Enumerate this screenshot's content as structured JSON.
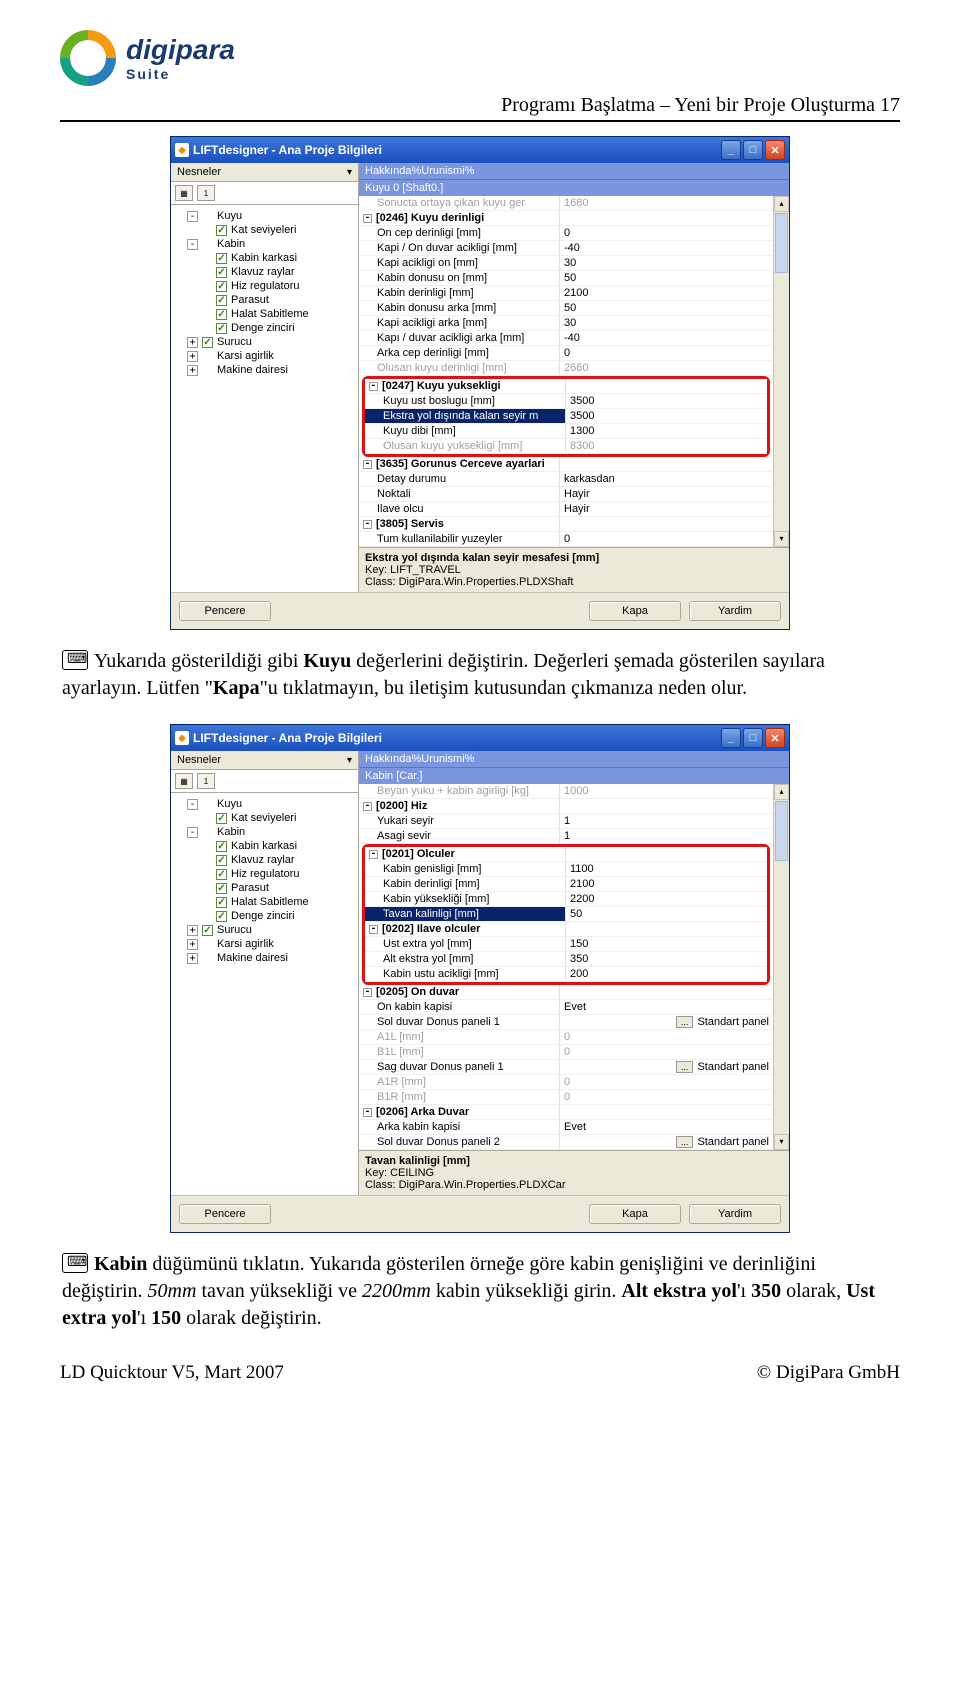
{
  "header": {
    "logo_main": "digipara",
    "logo_sub": "Suite",
    "breadcrumb": "Programı Başlatma – Yeni bir Proje Oluşturma   17"
  },
  "win1": {
    "title": "LIFTdesigner - Ana Proje Bilgileri",
    "left_head": "Nesneler",
    "right_head1": "Hakkında%Urunismi%",
    "right_head2": "Kuyu 0 [Shaft0.]",
    "tree": [
      {
        "exp": "-",
        "chk": null,
        "label": "Kuyu",
        "children": [
          {
            "exp": null,
            "chk": "✓",
            "label": "Kat seviyeleri"
          }
        ]
      },
      {
        "exp": "-",
        "chk": null,
        "label": "Kabin",
        "children": [
          {
            "exp": null,
            "chk": "✓",
            "label": "Kabin karkasi"
          },
          {
            "exp": null,
            "chk": "✓",
            "label": "Klavuz raylar"
          },
          {
            "exp": null,
            "chk": "✓",
            "label": "Hiz regulatoru"
          },
          {
            "exp": null,
            "chk": "✓",
            "label": "Parasut"
          },
          {
            "exp": null,
            "chk": "✓",
            "label": "Halat Sabitleme"
          },
          {
            "exp": null,
            "chk": "✓",
            "label": "Denge zinciri"
          }
        ]
      },
      {
        "exp": "+",
        "chk": "✓",
        "label": "Surucu"
      },
      {
        "exp": "+",
        "chk": null,
        "label": "Karsi agirlik"
      },
      {
        "exp": "+",
        "chk": null,
        "label": "Makine dairesi"
      }
    ],
    "rows": [
      {
        "type": "gray",
        "l": "Sonucta ortaya çikan kuyu ger",
        "r": "1680"
      },
      {
        "type": "head",
        "l": "[0246] Kuyu derinligi",
        "r": ""
      },
      {
        "type": "",
        "l": "On cep derinligi [mm]",
        "r": "0"
      },
      {
        "type": "",
        "l": "Kapi / On duvar acikligi [mm]",
        "r": "-40"
      },
      {
        "type": "",
        "l": "Kapi acikligi on  [mm]",
        "r": "30"
      },
      {
        "type": "",
        "l": "Kabin donusu on  [mm]",
        "r": "50"
      },
      {
        "type": "",
        "l": "Kabin derinligi [mm]",
        "r": "2100"
      },
      {
        "type": "",
        "l": "Kabin donusu arka  [mm]",
        "r": "50"
      },
      {
        "type": "",
        "l": "Kapi acikligi  arka  [mm]",
        "r": "30"
      },
      {
        "type": "",
        "l": "Kapı / duvar acikligi  arka [mm]",
        "r": "-40"
      },
      {
        "type": "",
        "l": "Arka cep  derinligi [mm]",
        "r": "0"
      },
      {
        "type": "gray",
        "l": "Olusan kuyu derinligi [mm]",
        "r": "2660"
      }
    ],
    "redbox_rows": [
      {
        "type": "head",
        "l": "[0247] Kuyu yuksekligi",
        "r": ""
      },
      {
        "type": "",
        "l": "Kuyu ust boslugu [mm]",
        "r": "3500"
      },
      {
        "type": "sel",
        "l": "Ekstra yol dışında kalan seyir m",
        "r": "3500"
      },
      {
        "type": "",
        "l": "Kuyu dibi [mm]",
        "r": "1300"
      },
      {
        "type": "gray",
        "l": "Olusan  kuyu yuksekligi [mm]",
        "r": "8300"
      }
    ],
    "rows2": [
      {
        "type": "head",
        "l": "[3635] Gorunus Cerceve ayarlari",
        "r": ""
      },
      {
        "type": "",
        "l": "Detay  durumu",
        "r": "karkasdan"
      },
      {
        "type": "",
        "l": "Noktali",
        "r": "Hayir"
      },
      {
        "type": "",
        "l": "Ilave olcu",
        "r": "Hayir"
      },
      {
        "type": "head",
        "l": "[3805] Servis",
        "r": ""
      },
      {
        "type": "",
        "l": "Tum kullanilabilir yuzeyler",
        "r": "0"
      }
    ],
    "info_title": "Ekstra yol dışında kalan seyir mesafesi [mm]",
    "info_key": "Key: LIFT_TRAVEL",
    "info_class": "Class: DigiPara.Win.Properties.PLDXShaft",
    "btn_left": "Pencere",
    "btn_kapa": "Kapa",
    "btn_yardim": "Yardim"
  },
  "text1": {
    "pre": "Yukarıda gösterildiği gibi ",
    "b1": "Kuyu",
    "mid": " değerlerini değiştirin. Değerleri şemada gösterilen sayılara ayarlayın. Lütfen \"",
    "b2": "Kapa",
    "post": "\"u tıklatmayın, bu iletişim kutusundan çıkmanıza neden olur."
  },
  "win2": {
    "title": "LIFTdesigner - Ana Proje Bilgileri",
    "left_head": "Nesneler",
    "right_head1": "Hakkında%Urunismi%",
    "right_head2": "Kabin [Car.]",
    "tree": [
      {
        "exp": "-",
        "chk": null,
        "label": "Kuyu",
        "children": [
          {
            "exp": null,
            "chk": "✓",
            "label": "Kat seviyeleri"
          }
        ]
      },
      {
        "exp": "-",
        "chk": null,
        "label": "Kabin",
        "children": [
          {
            "exp": null,
            "chk": "✓",
            "label": "Kabin karkasi"
          },
          {
            "exp": null,
            "chk": "✓",
            "label": "Klavuz raylar"
          },
          {
            "exp": null,
            "chk": "✓",
            "label": "Hiz regulatoru"
          },
          {
            "exp": null,
            "chk": "✓",
            "label": "Parasut"
          },
          {
            "exp": null,
            "chk": "✓",
            "label": "Halat Sabitleme"
          },
          {
            "exp": null,
            "chk": "✓",
            "label": "Denge zinciri"
          }
        ]
      },
      {
        "exp": "+",
        "chk": "✓",
        "label": "Surucu"
      },
      {
        "exp": "+",
        "chk": null,
        "label": "Karsi agirlik"
      },
      {
        "exp": "+",
        "chk": null,
        "label": "Makine dairesi"
      }
    ],
    "rows_top": [
      {
        "type": "gray",
        "l": "Beyan yuku + kabin agirligi [kg]",
        "r": "1000"
      },
      {
        "type": "head",
        "l": "[0200] Hiz",
        "r": ""
      },
      {
        "type": "",
        "l": "Yukari seyir",
        "r": "1"
      },
      {
        "type": "",
        "l": "Asagi sevir",
        "r": "1"
      }
    ],
    "redbox_rows": [
      {
        "type": "head",
        "l": "[0201] Olculer",
        "r": ""
      },
      {
        "type": "",
        "l": "Kabin genisligi [mm]",
        "r": "1100"
      },
      {
        "type": "",
        "l": "Kabin derinligi [mm]",
        "r": "2100"
      },
      {
        "type": "",
        "l": "Kabin yüksekliği [mm]",
        "r": "2200"
      },
      {
        "type": "sel",
        "l": "Tavan kalinligi  [mm]",
        "r": "50"
      },
      {
        "type": "head",
        "l": "[0202] Ilave olculer",
        "r": ""
      },
      {
        "type": "",
        "l": "Ust extra yol [mm]",
        "r": "150"
      },
      {
        "type": "",
        "l": "Alt ekstra yol [mm]",
        "r": "350"
      },
      {
        "type": "",
        "l": "Kabin ustu acikligi [mm]",
        "r": "200"
      }
    ],
    "rows2": [
      {
        "type": "head",
        "l": "[0205] On duvar",
        "r": ""
      },
      {
        "type": "",
        "l": "On kabin kapisi",
        "r": "Evet"
      },
      {
        "type": "dots",
        "l": "Sol duvar  Donus paneli 1",
        "r": "Standart panel"
      },
      {
        "type": "gray",
        "l": "A1L [mm]",
        "r": "0"
      },
      {
        "type": "gray",
        "l": "B1L [mm]",
        "r": "0"
      },
      {
        "type": "dots",
        "l": "Sag duvar Donus paneli  1",
        "r": "Standart panel"
      },
      {
        "type": "gray",
        "l": "A1R [mm]",
        "r": "0"
      },
      {
        "type": "gray",
        "l": "B1R [mm]",
        "r": "0"
      },
      {
        "type": "head",
        "l": "[0206] Arka Duvar",
        "r": ""
      },
      {
        "type": "",
        "l": "Arka kabin kapisi",
        "r": "Evet"
      },
      {
        "type": "dots",
        "l": "Sol duvar  Donus paneli  2",
        "r": "Standart panel"
      }
    ],
    "info_title": "Tavan kalinligi [mm]",
    "info_key": "Key: CEILING",
    "info_class": "Class: DigiPara.Win.Properties.PLDXCar",
    "btn_left": "Pencere",
    "btn_kapa": "Kapa",
    "btn_yardim": "Yardim"
  },
  "text2": {
    "b1": "Kabin",
    "p1": " düğümünü tıklatın. Yukarıda gösterilen örneğe göre kabin genişliğini ve derinliğini değiştirin. ",
    "i1": "50mm",
    "p2": " tavan yüksekliği ve ",
    "i2": "2200mm",
    "p3": " kabin yüksekliği girin. ",
    "b2": "Alt ekstra yol",
    "p4": "'ı ",
    "b3": "350",
    "p5": " olarak, ",
    "b4": "Ust extra yol",
    "p6": "'ı ",
    "b5": "150",
    "p7": " olarak değiştirin."
  },
  "footer": {
    "left": "LD Quicktour V5, Mart 2007",
    "right": "© DigiPara GmbH"
  }
}
